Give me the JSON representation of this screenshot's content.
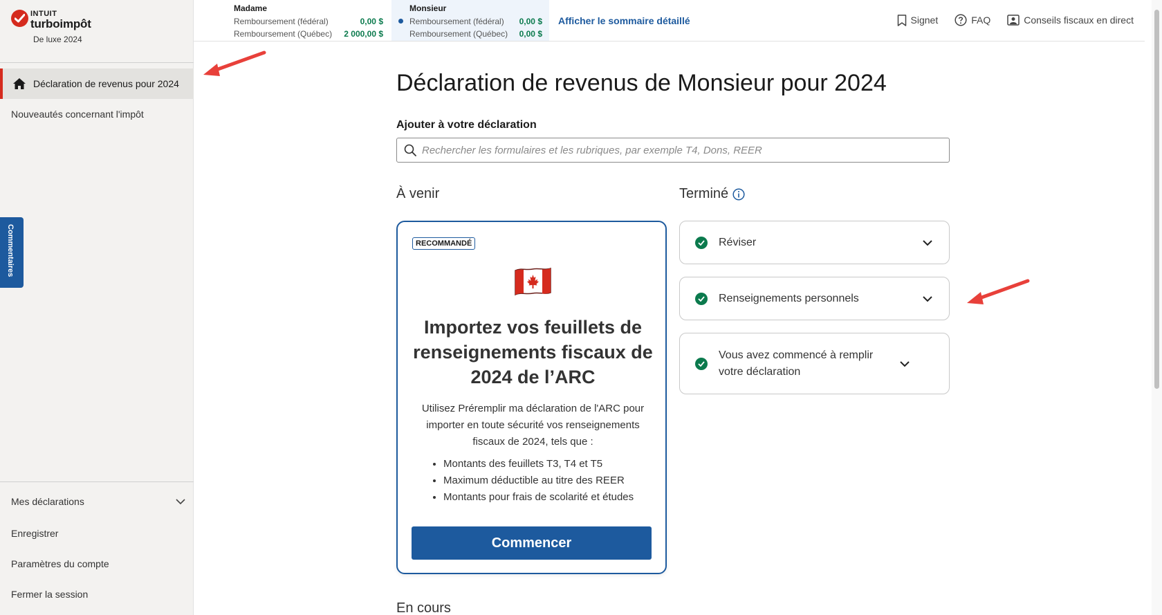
{
  "app": {
    "brand_small": "INTUIT",
    "brand": "turboimpôt",
    "edition": "De luxe 2024"
  },
  "sidebar": {
    "active_item": "Déclaration de revenus pour 2024",
    "items": [
      "Nouveautés concernant l'impôt"
    ],
    "bottom_items": {
      "mes_declarations": "Mes déclarations",
      "save": "Enregistrer",
      "account": "Paramètres du compte",
      "logout": "Fermer la session"
    },
    "feedback": "Commentaires"
  },
  "header": {
    "spouse_f": {
      "name": "Madame",
      "rows": [
        {
          "label": "Remboursement (fédéral)",
          "amount": "0,00  $"
        },
        {
          "label": "Remboursement (Québec)",
          "amount": "2 000,00  $"
        }
      ]
    },
    "spouse_m": {
      "name": "Monsieur",
      "rows": [
        {
          "label": "Remboursement (fédéral)",
          "amount": "0,00  $"
        },
        {
          "label": "Remboursement (Québec)",
          "amount": "0,00  $"
        }
      ]
    },
    "summary_link": "Afficher le sommaire détaillé",
    "actions": {
      "bookmark": "Signet",
      "faq": "FAQ",
      "live": "Conseils fiscaux en direct"
    }
  },
  "main": {
    "title": "Déclaration de revenus de Monsieur pour 2024",
    "add_label": "Ajouter à votre déclaration",
    "search_placeholder": "Rechercher les formulaires et les rubriques, par exemple T4, Dons, REER",
    "upcoming_heading": "À venir",
    "done_heading": "Terminé",
    "in_progress_heading": "En cours",
    "card": {
      "badge": "RECOMMANDÉ",
      "title": "Importez vos feuillets de renseignements fiscaux de 2024 de l’ARC",
      "description": "Utilisez Préremplir ma déclaration de l'ARC pour importer en toute sécurité vos renseignements fiscaux de 2024, tels que :",
      "bullets": [
        "Montants des feuillets T3, T4 et T5",
        "Maximum déductible au titre des REER",
        "Montants pour frais de scolarité et études"
      ],
      "button": "Commencer"
    },
    "done_items": [
      "Réviser",
      "Renseignements personnels",
      "Vous avez commencé à remplir votre déclaration"
    ]
  },
  "colors": {
    "accent_blue": "#1d5a9e",
    "brand_red": "#d52b1e",
    "success_green": "#0b7a4d",
    "annotation_arrow": "#e8403a"
  }
}
